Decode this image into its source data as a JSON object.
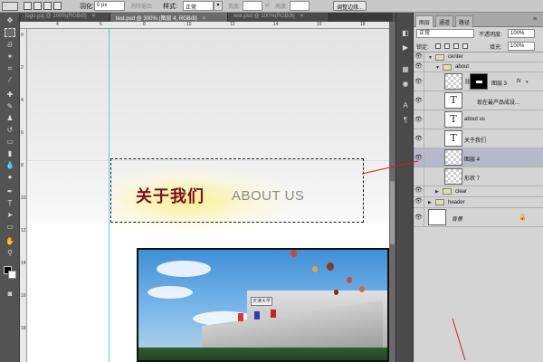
{
  "options_bar": {
    "feather_label": "羽化:",
    "feather_value": "0 px",
    "antialias_label": "消除锯齿",
    "style_label": "样式:",
    "style_value": "正常",
    "width_label": "宽度:",
    "height_label": "高度:",
    "refine_edge_button": "调整边缘..."
  },
  "tabs": [
    {
      "label": "logo.jpg @ 100%(RGB/8)",
      "close": "×"
    },
    {
      "label": "test.psd @ 300% (图层 4, RGB/8)",
      "close": "×"
    },
    {
      "label": "test.psd @ 100%(RGB/8)",
      "close": "×"
    }
  ],
  "ruler": {
    "h_numbers": [
      "4",
      "6",
      "8",
      "10",
      "12",
      "14",
      "16",
      "18"
    ],
    "v_numbers": [
      "0",
      "2",
      "4",
      "6",
      "8",
      "10",
      "12",
      "14",
      "16",
      "18"
    ]
  },
  "canvas": {
    "about_cn": "关于我们",
    "about_en": "ABOUT US",
    "photo_sign": "天津大学"
  },
  "layers_panel": {
    "tabs": [
      "图层",
      "通道",
      "路径"
    ],
    "blend_mode": "正常",
    "opacity_label": "不透明度:",
    "opacity_value": "100%",
    "lock_label": "锁定:",
    "fill_label": "填充:",
    "fill_value": "100%",
    "layers": [
      {
        "name": "center",
        "kind": "group",
        "indent": 0,
        "expanded": true,
        "visible": true
      },
      {
        "name": "about",
        "kind": "group",
        "indent": 1,
        "expanded": true,
        "visible": true
      },
      {
        "name": "图层 3",
        "kind": "masked",
        "indent": 2,
        "visible": true,
        "fx": "fx"
      },
      {
        "name": "现在最产品成设...",
        "kind": "text",
        "indent": 2,
        "visible": true
      },
      {
        "name": "about us",
        "kind": "text",
        "indent": 2,
        "visible": true
      },
      {
        "name": "关于我们",
        "kind": "text",
        "indent": 2,
        "visible": true
      },
      {
        "name": "图层 4",
        "kind": "pixel",
        "indent": 2,
        "visible": true,
        "selected": true
      },
      {
        "name": "形状 7",
        "kind": "pixel",
        "indent": 2,
        "visible": false
      },
      {
        "name": "clear",
        "kind": "group",
        "indent": 1,
        "expanded": false,
        "visible": true
      },
      {
        "name": "header",
        "kind": "group",
        "indent": 0,
        "expanded": false,
        "visible": true
      },
      {
        "name": "背景",
        "kind": "background",
        "indent": 0,
        "visible": true,
        "locked": true
      }
    ]
  },
  "icons": {
    "eye": "eye-icon",
    "folder": "folder-icon",
    "lock": "lock-icon",
    "expand": "triangle-icon"
  },
  "colors": {
    "about_cn": "#7a0f14",
    "about_en": "#8a8a8a",
    "selected_layer": "#b7b8c9",
    "guide": "#5ad0d8",
    "annotation": "#d02020"
  }
}
